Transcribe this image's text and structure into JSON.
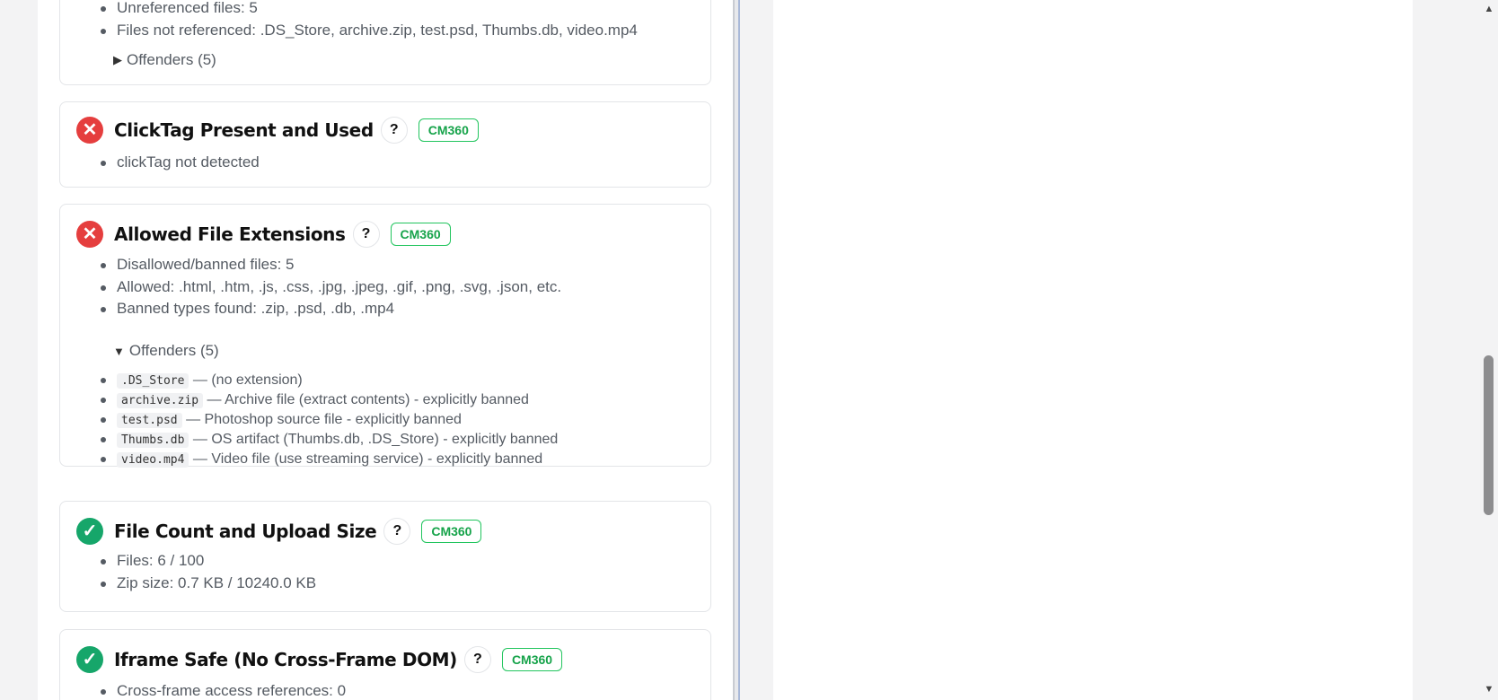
{
  "cards": [
    {
      "details": [
        "Unreferenced files: 5",
        "Files not referenced: .DS_Store, archive.zip, test.psd, Thumbs.db, video.mp4"
      ],
      "offenders_label": "Offenders (5)"
    },
    {
      "title": "ClickTag Present and Used",
      "status": "fail",
      "status_icon": "x-icon",
      "help": "?",
      "tag": "CM360",
      "details": [
        "clickTag not detected"
      ]
    },
    {
      "title": "Allowed File Extensions",
      "status": "fail",
      "status_icon": "x-icon",
      "help": "?",
      "tag": "CM360",
      "details": [
        "Disallowed/banned files: 5",
        "Allowed: .html, .htm, .js, .css, .jpg, .jpeg, .gif, .png, .svg, .json, etc.",
        "Banned types found: .zip, .psd, .db, .mp4"
      ],
      "offenders_label": "Offenders (5)",
      "offenders": [
        {
          "file": ".DS_Store",
          "note": "— (no extension)"
        },
        {
          "file": "archive.zip",
          "note": "— Archive file (extract contents) - explicitly banned"
        },
        {
          "file": "test.psd",
          "note": "— Photoshop source file - explicitly banned"
        },
        {
          "file": "Thumbs.db",
          "note": "— OS artifact (Thumbs.db, .DS_Store) - explicitly banned"
        },
        {
          "file": "video.mp4",
          "note": "— Video file (use streaming service) - explicitly banned"
        }
      ]
    },
    {
      "title": "File Count and Upload Size",
      "status": "pass",
      "status_icon": "check-icon",
      "help": "?",
      "tag": "CM360",
      "details": [
        "Files: 6 / 100",
        "Zip size: 0.7 KB / 10240.0 KB"
      ]
    },
    {
      "title": "Iframe Safe (No Cross-Frame DOM)",
      "status": "pass",
      "status_icon": "check-icon",
      "help": "?",
      "tag": "CM360",
      "details": [
        "Cross-frame access references: 0"
      ]
    }
  ],
  "icons": {
    "fail": "✕",
    "pass": "✓",
    "collapsed": "▶",
    "expanded": "▼",
    "scroll_up": "▲",
    "scroll_down": "▼"
  },
  "colors": {
    "fail": "#e53e3e",
    "pass": "#16a66a",
    "tag": "#22c55e"
  }
}
